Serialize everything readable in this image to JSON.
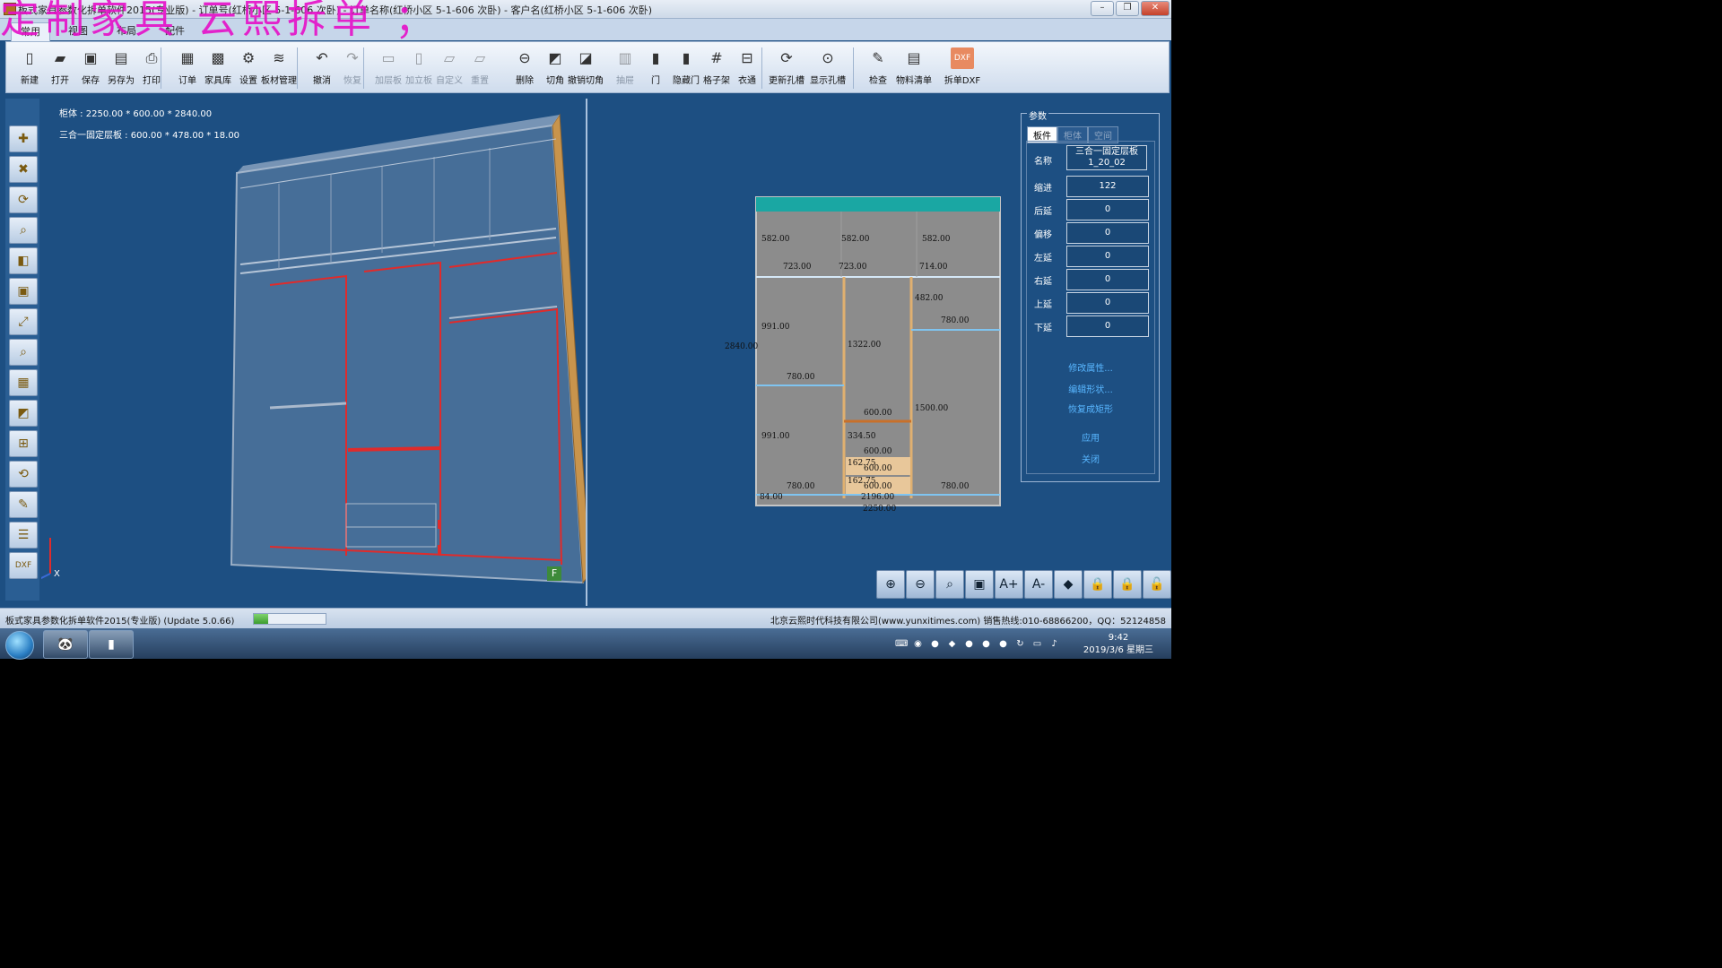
{
  "window": {
    "title": "板式家具参数化拆单软件2015(专业版) - 订单号(红桥小区 5-1-606 次卧) - 订单名称(红桥小区 5-1-606 次卧) - 客户名(红桥小区 5-1-606 次卧)",
    "minimize": "–",
    "maximize": "❐",
    "close": "✕"
  },
  "watermark": "定制家具 云熙拆单 ；",
  "ribbon_tabs": [
    "常用",
    "视图",
    "布局",
    "配件"
  ],
  "toolbar": [
    {
      "label": "新建",
      "icon": "new-file-icon",
      "glyph": "▯",
      "enabled": true
    },
    {
      "label": "打开",
      "icon": "open-folder-icon",
      "glyph": "▰",
      "enabled": true
    },
    {
      "label": "保存",
      "icon": "save-icon",
      "glyph": "▣",
      "enabled": true
    },
    {
      "label": "另存为",
      "icon": "save-as-icon",
      "glyph": "▤",
      "enabled": true
    },
    {
      "label": "打印",
      "icon": "print-icon",
      "glyph": "⎙",
      "enabled": true
    },
    {
      "label": "订单",
      "icon": "order-icon",
      "glyph": "▦",
      "enabled": true
    },
    {
      "label": "家具库",
      "icon": "furniture-library-icon",
      "glyph": "▩",
      "enabled": true
    },
    {
      "label": "设置",
      "icon": "settings-icon",
      "glyph": "⚙",
      "enabled": true
    },
    {
      "label": "板材管理",
      "icon": "board-manage-icon",
      "glyph": "≋",
      "enabled": true
    },
    {
      "label": "撤消",
      "icon": "undo-icon",
      "glyph": "↶",
      "enabled": true
    },
    {
      "label": "恢复",
      "icon": "redo-icon",
      "glyph": "↷",
      "enabled": false
    },
    {
      "label": "加层板",
      "icon": "add-shelf-icon",
      "glyph": "▭",
      "enabled": false
    },
    {
      "label": "加立板",
      "icon": "add-vertical-board-icon",
      "glyph": "▯",
      "enabled": false
    },
    {
      "label": "自定义",
      "icon": "custom-icon",
      "glyph": "▱",
      "enabled": false
    },
    {
      "label": "重置",
      "icon": "reset-icon",
      "glyph": "▱",
      "enabled": false
    },
    {
      "label": "删除",
      "icon": "delete-icon",
      "glyph": "⊖",
      "enabled": true
    },
    {
      "label": "切角",
      "icon": "cut-corner-icon",
      "glyph": "◩",
      "enabled": true
    },
    {
      "label": "撤销切角",
      "icon": "undo-cut-corner-icon",
      "glyph": "◪",
      "enabled": true
    },
    {
      "label": "抽屉",
      "icon": "drawer-icon",
      "glyph": "▥",
      "enabled": false
    },
    {
      "label": "门",
      "icon": "door-icon",
      "glyph": "▮",
      "enabled": true
    },
    {
      "label": "隐藏门",
      "icon": "hide-door-icon",
      "glyph": "▮",
      "enabled": true
    },
    {
      "label": "格子架",
      "icon": "grid-rack-icon",
      "glyph": "#",
      "enabled": true
    },
    {
      "label": "衣通",
      "icon": "hanging-rod-icon",
      "glyph": "⊟",
      "enabled": true
    },
    {
      "label": "更新孔槽",
      "icon": "update-holes-icon",
      "glyph": "⟳",
      "enabled": true
    },
    {
      "label": "显示孔槽",
      "icon": "show-holes-icon",
      "glyph": "⊙",
      "enabled": true
    },
    {
      "label": "检查",
      "icon": "check-icon",
      "glyph": "✎",
      "enabled": true
    },
    {
      "label": "物料清单",
      "icon": "bom-icon",
      "glyph": "▤",
      "enabled": true
    },
    {
      "label": "拆单DXF",
      "icon": "dxf-export-icon",
      "glyph": "DXF",
      "enabled": true
    }
  ],
  "left_tools": [
    {
      "icon": "add-part-icon",
      "glyph": "✚"
    },
    {
      "icon": "remove-part-icon",
      "glyph": "✖"
    },
    {
      "icon": "rotate-icon",
      "glyph": "⟳"
    },
    {
      "icon": "zoom-icon",
      "glyph": "⌕"
    },
    {
      "icon": "material-icon",
      "glyph": "◧"
    },
    {
      "icon": "screenshot-icon",
      "glyph": "▣"
    },
    {
      "icon": "expand-icon",
      "glyph": "⤢"
    },
    {
      "icon": "inspect-icon",
      "glyph": "⌕"
    },
    {
      "icon": "wireframe-icon",
      "glyph": "▦"
    },
    {
      "icon": "texture-icon",
      "glyph": "◩"
    },
    {
      "icon": "add-view-icon",
      "glyph": "⊞"
    },
    {
      "icon": "refresh-view-icon",
      "glyph": "⟲"
    },
    {
      "icon": "edit-view-icon",
      "glyph": "✎"
    },
    {
      "icon": "list-view-icon",
      "glyph": "☰"
    },
    {
      "icon": "dxf-icon",
      "glyph": "DXF"
    }
  ],
  "view3d": {
    "cabinet_info": "柜体 : 2250.00 * 600.00 * 2840.00",
    "selected_info": "三合一固定层板 : 600.00 * 478.00 * 18.00",
    "axis_label": "X",
    "face_label": "F"
  },
  "view2d": {
    "dims": [
      "582.00",
      "582.00",
      "582.00",
      "723.00",
      "723.00",
      "714.00",
      "482.00",
      "780.00",
      "991.00",
      "1322.00",
      "2840.00",
      "780.00",
      "600.00",
      "1500.00",
      "991.00",
      "334.50",
      "600.00",
      "162.75",
      "600.00",
      "162.75",
      "600.00",
      "780.00",
      "780.00",
      "84.00",
      "2196.00",
      "2250.00"
    ]
  },
  "params": {
    "title": "参数",
    "tabs": [
      "板件",
      "柜体",
      "空间"
    ],
    "active_tab": "板件",
    "rows": [
      {
        "label": "名称",
        "value": "三合一固定层板\n1_20_02"
      },
      {
        "label": "缩进",
        "value": "122"
      },
      {
        "label": "后延",
        "value": "0"
      },
      {
        "label": "偏移",
        "value": "0"
      },
      {
        "label": "左延",
        "value": "0"
      },
      {
        "label": "右延",
        "value": "0"
      },
      {
        "label": "上延",
        "value": "0"
      },
      {
        "label": "下延",
        "value": "0"
      }
    ],
    "links": [
      "修改属性...",
      "编辑形状...",
      "恢复成矩形",
      "应用",
      "关闭"
    ]
  },
  "zoom_tools": [
    {
      "icon": "zoom-in-icon",
      "glyph": "⊕"
    },
    {
      "icon": "zoom-out-icon",
      "glyph": "⊖"
    },
    {
      "icon": "zoom-fit-icon",
      "glyph": "⌕"
    },
    {
      "icon": "snapshot-icon",
      "glyph": "▣"
    },
    {
      "icon": "font-increase-icon",
      "glyph": "A+"
    },
    {
      "icon": "font-decrease-icon",
      "glyph": "A-"
    },
    {
      "icon": "tag-icon",
      "glyph": "◆"
    },
    {
      "icon": "lock-icon",
      "glyph": "🔒"
    },
    {
      "icon": "lock-alt-icon",
      "glyph": "🔒"
    },
    {
      "icon": "unlock-icon",
      "glyph": "🔓"
    }
  ],
  "status": {
    "left": "板式家具参数化拆单软件2015(专业版) (Update 5.0.66)",
    "right": "北京云熙时代科技有限公司(www.yunxitimes.com)  销售热线:010-68866200，QQ：52124858",
    "progress": 0.2
  },
  "taskbar": {
    "time": "9:42",
    "date": "2019/3/6 星期三",
    "apps": [
      {
        "icon": "panda-app-icon",
        "glyph": "🐼"
      },
      {
        "icon": "cabinet-app-icon",
        "glyph": "▮"
      }
    ]
  },
  "colors": {
    "viewport_bg": "#1d4f82",
    "highlight": "#e02b2b",
    "link": "#58b6ff",
    "teal_top": "#1aa7a3"
  }
}
